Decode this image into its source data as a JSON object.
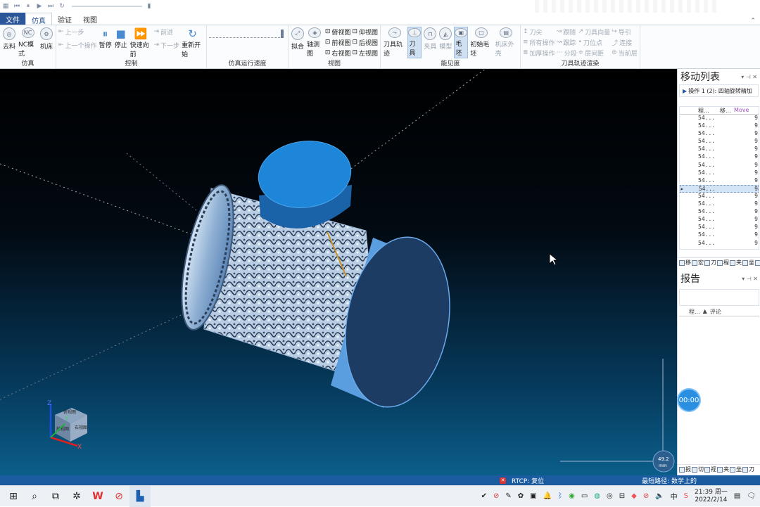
{
  "titlebar": {
    "icons": [
      "app-icon",
      "step-back-icon",
      "pause-icon",
      "play-icon",
      "fast-forward-icon",
      "loop-icon"
    ]
  },
  "menu": {
    "file": "文件",
    "tabs": [
      "仿真",
      "验证",
      "视图"
    ],
    "active": "仿真"
  },
  "ribbon": {
    "sim": {
      "name": "仿真",
      "remove": "去料",
      "nc_mode": "NC模式",
      "machine": "机床"
    },
    "control": {
      "name": "控制",
      "prev_step": "上一步",
      "prev_op": "上一个操作",
      "pause": "暂停",
      "stop": "停止",
      "fast_forward": "快速向前",
      "forward": "前进",
      "next_step": "下一步",
      "restart": "重新开始"
    },
    "speed": {
      "name": "仿真运行速度"
    },
    "view": {
      "name": "视图",
      "fit": "拟合",
      "iso": "轴测图",
      "top": "俯视图",
      "bottom": "仰视图",
      "front": "前视图",
      "back": "后视图",
      "right": "右视图",
      "left": "左视图"
    },
    "visibility": {
      "name": "能见度",
      "toolpath": "刀具轨迹",
      "tool": "刀具",
      "fixture": "夹具",
      "model": "模型",
      "stock": "毛坯",
      "init_stock": "初始毛坯",
      "machine_shell": "机床外壳"
    },
    "render": {
      "name": "刀具轨迹渲染",
      "tooltip": "刀尖",
      "all_ops": "所有操作",
      "thick_op": "加厚操作",
      "follow": "跟随",
      "trace": "跟踪",
      "segment": "分段",
      "tool_vector": "刀具向量",
      "tool_point": "刀位点",
      "layer_gap": "层间距",
      "lead": "导引",
      "link": "连接",
      "current_layer": "当前层"
    }
  },
  "move_list": {
    "title": "移动列表",
    "operation": "操作 1 (2): 四轴旋转精加",
    "headers": [
      "程...",
      "移...",
      "Move"
    ],
    "rows": [
      "54...",
      "54...",
      "54...",
      "54...",
      "54...",
      "54...",
      "54...",
      "54...",
      "54...",
      "54...",
      "54...",
      "54...",
      "54...",
      "54...",
      "54...",
      "54...",
      "54..."
    ],
    "move_val": "9",
    "selected_index": 9,
    "tabs": [
      "移",
      "宏",
      "刀",
      "程",
      "夹",
      "坐",
      "刀"
    ]
  },
  "report": {
    "title": "报告",
    "headers": [
      "程...",
      "评论"
    ],
    "tabs": [
      "报",
      "切",
      "视",
      "夹",
      "坐",
      "刀"
    ]
  },
  "viewport": {
    "cube_label_front": "前视图",
    "cube_label_right": "右视图",
    "cube_label_top": "俯视图",
    "axis_x": "X",
    "axis_y": "Y",
    "axis_z": "Z",
    "scale_value": "49.2",
    "scale_unit": "mm"
  },
  "timer": "00:00",
  "status": {
    "rtcp": "RTCP: 复位",
    "path": "最短路径: 数学上的"
  },
  "taskbar": {
    "ime": "中",
    "time": "21:39 周一",
    "date": "2022/2/14"
  },
  "colors": {
    "tool": "#1e86d8",
    "stock_end": "#1c3c63",
    "stock_side": "#5b9ee0",
    "ribbon_blue": "#2b579a"
  }
}
